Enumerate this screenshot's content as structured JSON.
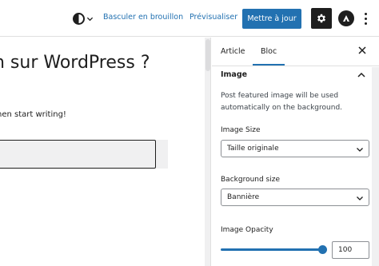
{
  "toolbar": {
    "style_icon": "half-circle-icon",
    "switch_draft_label": "Basculer en brouillon",
    "preview_label": "Prévisualiser",
    "update_label": "Mettre à jour",
    "settings_icon": "gear-icon",
    "plugin_icon": "plugin-logo-icon",
    "more_icon": "vertical-ellipsis-icon"
  },
  "editor": {
    "title_fragment": "n sur WordPress ?",
    "paragraph_fragment": "hen start writing!"
  },
  "sidebar": {
    "tabs": [
      {
        "label": "Article",
        "active": false
      },
      {
        "label": "Bloc",
        "active": true
      }
    ],
    "panel": {
      "title": "Image",
      "description": "Post featured image will be used automatically on the background.",
      "image_size": {
        "label": "Image Size",
        "value": "Taille originale"
      },
      "background_size": {
        "label": "Background size",
        "value": "Bannière"
      },
      "opacity": {
        "label": "Image Opacity",
        "value": "100",
        "fraction": 1.0
      }
    }
  },
  "colors": {
    "accent": "#2271b1",
    "dark": "#1e1e1e",
    "border": "#e0e0e0"
  }
}
